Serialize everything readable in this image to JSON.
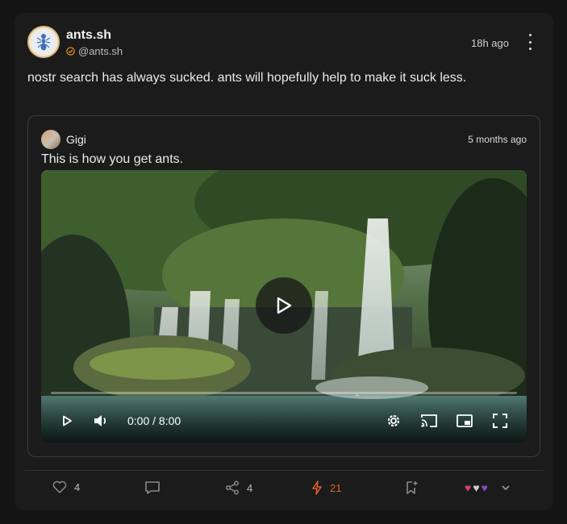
{
  "post": {
    "author_name": "ants.sh",
    "author_handle": "@ants.sh",
    "timestamp": "18h ago",
    "text": "nostr search has always sucked. ants will hopefully help to make it suck less."
  },
  "quoted": {
    "author_name": "Gigi",
    "timestamp": "5 months ago",
    "text": "This is how you get ants.",
    "video": {
      "current_time": "0:00 / 8:00",
      "progress": 0
    }
  },
  "actions": {
    "likes": "4",
    "reposts": "4",
    "zaps": "21"
  },
  "reactions": [
    "heart-red",
    "heart-white",
    "heart-purple"
  ],
  "colors": {
    "accent": "#f7931a",
    "zap": "#e0632d",
    "card_bg": "#1b1b1b",
    "page_bg": "#141414"
  }
}
